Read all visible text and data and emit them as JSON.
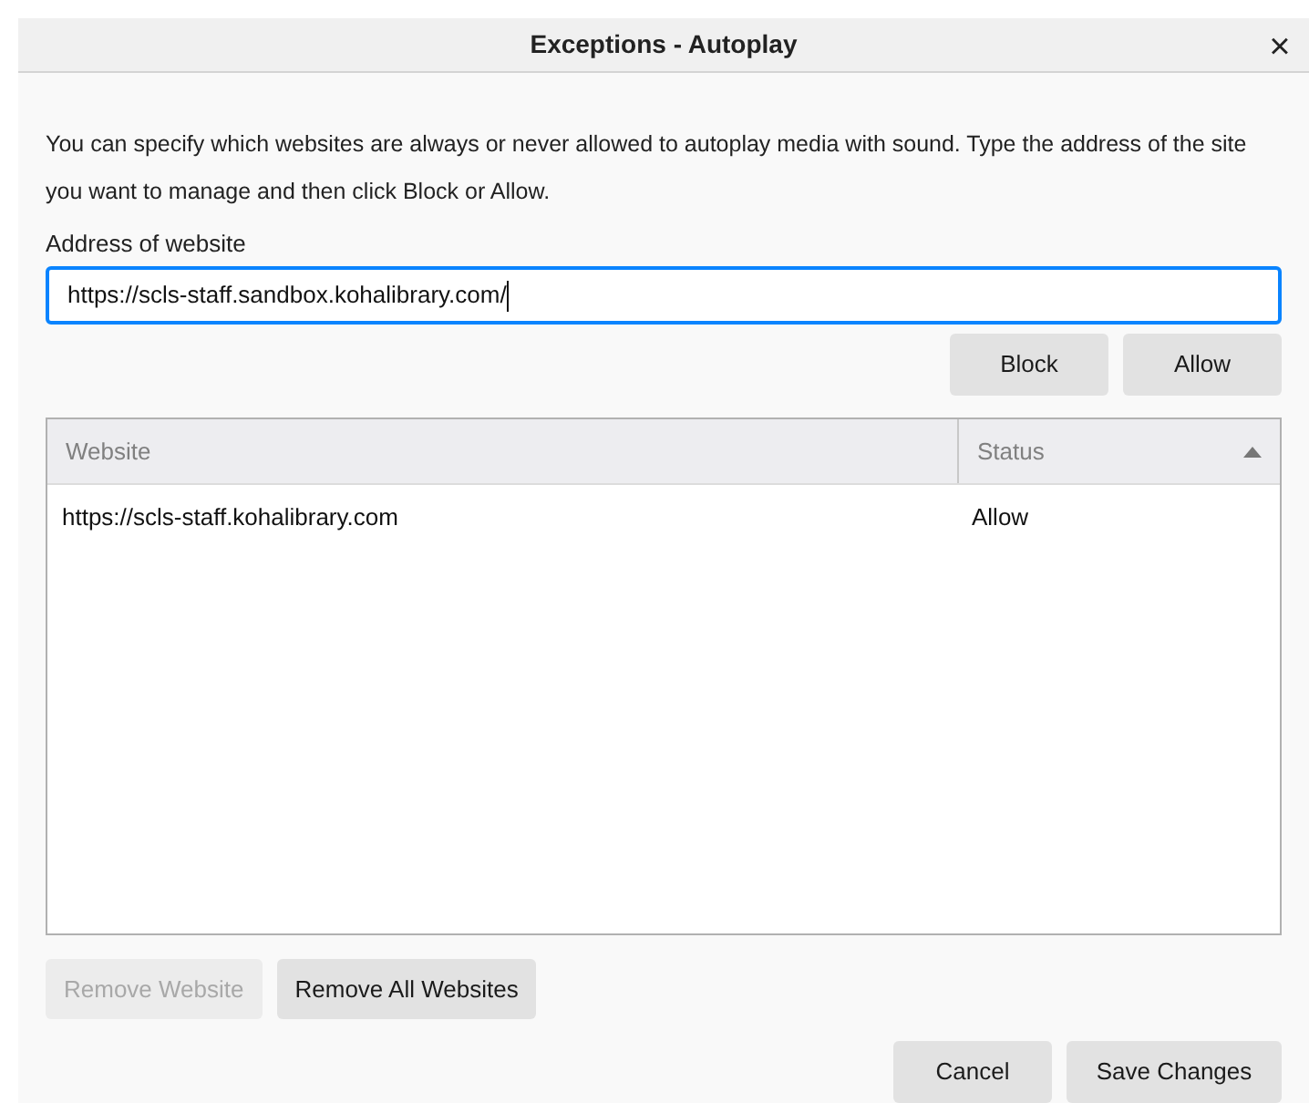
{
  "window": {
    "title": "Exceptions - Autoplay",
    "close": "×"
  },
  "description": "You can specify which websites are always or never allowed to autoplay media with sound. Type the address of the site you want to manage and then click Block or Allow.",
  "address": {
    "label": "Address of website",
    "value": "https://scls-staff.sandbox.kohalibrary.com/"
  },
  "entry_buttons": [
    "Block",
    "Allow"
  ],
  "table": {
    "columns": [
      {
        "label": "Website",
        "sorted": false
      },
      {
        "label": "Status",
        "sorted": true
      }
    ],
    "rows": [
      {
        "website": "https://scls-staff.kohalibrary.com",
        "status": "Allow"
      }
    ]
  },
  "remove_buttons": [
    {
      "label": "Remove Website",
      "disabled": true
    },
    {
      "label": "Remove All Websites",
      "disabled": false
    }
  ],
  "footer_buttons": [
    "Cancel",
    "Save Changes"
  ]
}
